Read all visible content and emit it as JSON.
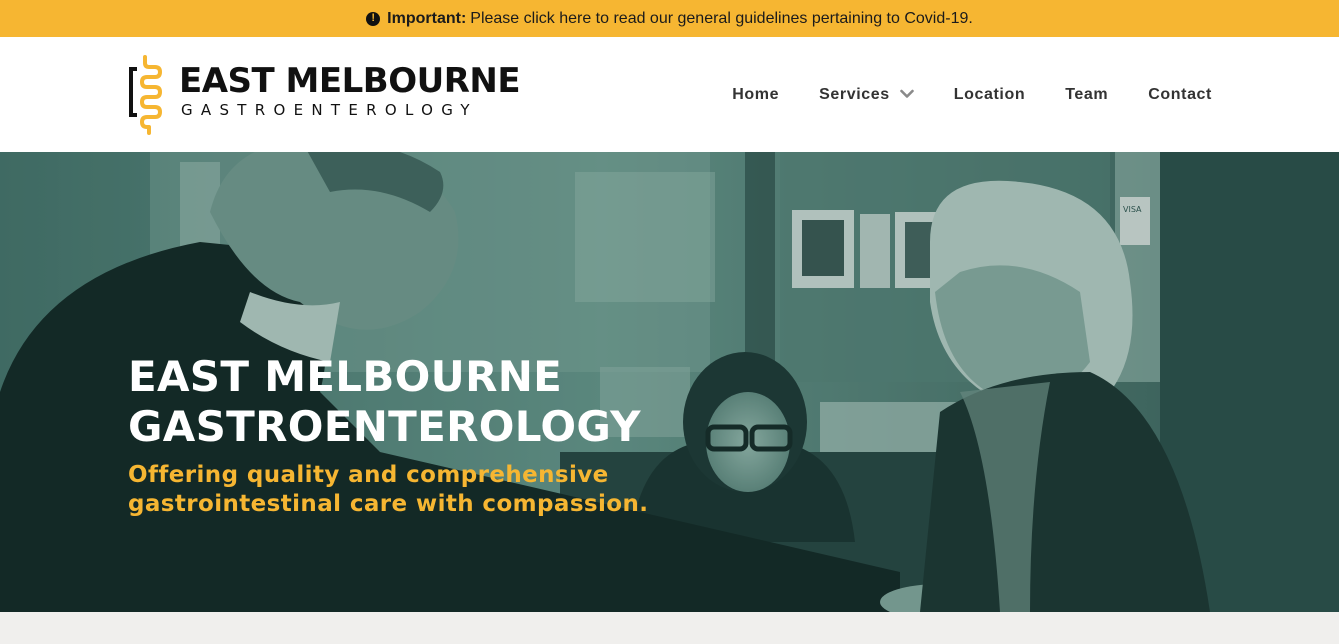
{
  "notice": {
    "icon": "exclamation-circle-icon",
    "strong": "Important:",
    "text": "Please click here to read our general guidelines pertaining to Covid-19.",
    "background": "#f6b632"
  },
  "logo": {
    "line1": "EAST MELBOURNE",
    "line2": "GASTROENTEROLOGY",
    "accent": "#f6b632",
    "icon": "intestine-icon"
  },
  "nav": {
    "items": [
      {
        "label": "Home"
      },
      {
        "label": "Services",
        "icon": "chevron-down-icon"
      },
      {
        "label": "Location"
      },
      {
        "label": "Team"
      },
      {
        "label": "Contact"
      }
    ]
  },
  "hero": {
    "title_line1": "EAST MELBOURNE",
    "title_line2": "GASTROENTEROLOGY",
    "subtitle_line1": "Offering quality and comprehensive",
    "subtitle_line2": "gastrointestinal care with compassion.",
    "tint": "#345a55",
    "image": "doctor-greeting-patient-photo",
    "sign_text": "VISA"
  }
}
